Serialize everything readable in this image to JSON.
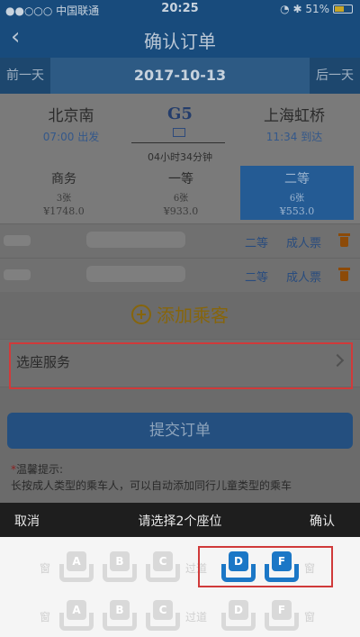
{
  "status_bar": {
    "carrier": "●●○○○ 中国联通 ",
    "time": "20:25",
    "right": "◔ ✱ 51%"
  },
  "nav": {
    "back_glyph": "‹",
    "title": "确认订单"
  },
  "date_bar": {
    "prev": "前一天",
    "date": "2017-10-13",
    "next": "后一天"
  },
  "train": {
    "from_station": "北京南",
    "from_time": "07:00 出发",
    "train_no": "G5",
    "to_station": "上海虹桥",
    "to_time": "11:34 到达",
    "duration": "04小时34分钟"
  },
  "seat_classes": [
    {
      "name": "商务",
      "count": "3张",
      "price": "¥1748.0"
    },
    {
      "name": "一等",
      "count": "6张",
      "price": "¥933.0"
    },
    {
      "name": "二等",
      "count": "6张",
      "price": "¥553.0",
      "selected": true
    }
  ],
  "passengers": [
    {
      "class": "二等",
      "type": "成人票"
    },
    {
      "class": "二等",
      "type": "成人票"
    }
  ],
  "add_passenger": "添加乘客",
  "seat_service": {
    "label": "选座服务"
  },
  "submit": "提交订单",
  "tip": {
    "star": "*",
    "title": "温馨提示:",
    "text": "长按成人类型的乘车人，可以自动添加同行儿童类型的乘车"
  },
  "picker": {
    "cancel": "取消",
    "title": "请选择2个座位",
    "confirm": "确认"
  },
  "seat_map": {
    "window": "窗",
    "aisle": "过道",
    "rows": [
      {
        "seats": [
          "A",
          "B",
          "C",
          "D",
          "F"
        ],
        "selected": [
          "D",
          "F"
        ]
      },
      {
        "seats": [
          "A",
          "B",
          "C",
          "D",
          "F"
        ],
        "selected": []
      }
    ]
  },
  "colors": {
    "selected_seat": "#1b77c6",
    "highlight": "#d03a3a",
    "nav": "#184b7c"
  }
}
